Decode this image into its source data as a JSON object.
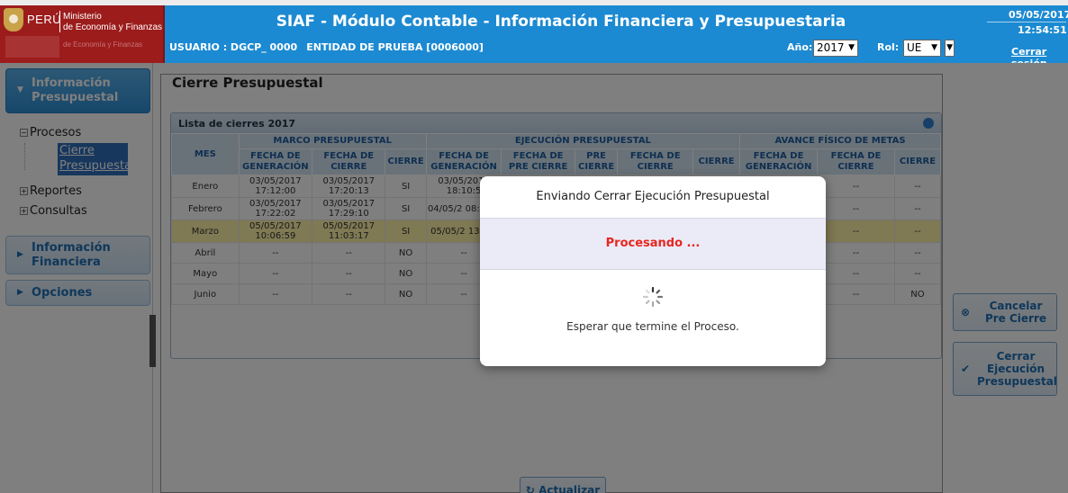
{
  "header": {
    "logo_country": "PERÚ",
    "logo_line1": "Ministerio",
    "logo_line2": "de Economía y Finanzas",
    "logo_line3": "de Economía y Finanzas",
    "title": "SIAF - Módulo Contable - Información Financiera y Presupuestaria",
    "user_label": "USUARIO : DGCP_ 0000",
    "entity_label": "ENTIDAD DE PRUEBA [0006000]",
    "year_label": "Año:",
    "year_value": "2017",
    "role_label": "Rol:",
    "role_value": "UE",
    "date": "05/05/2017",
    "time": "12:54:51",
    "logout": "Cerrar sesión"
  },
  "sidebar": {
    "section1": "Información Presupuestal",
    "procesos": "Procesos",
    "selected_l1": "Cierre",
    "selected_l2": "Presupuestal",
    "reportes": "Reportes",
    "consultas": "Consultas",
    "section2": "Información Financiera",
    "section3": "Opciones"
  },
  "main": {
    "legend": "Cierre Presupuestal",
    "panel_title": "Lista de cierres 2017",
    "groups": [
      "MES",
      "MARCO PRESUPUESTAL",
      "EJECUCIÓN PRESUPUESTAL",
      "AVANCE FÍSICO DE METAS"
    ],
    "columns": [
      "FECHA DE GENERACIÓN",
      "FECHA DE CIERRE",
      "CIERRE",
      "FECHA DE GENERACIÓN",
      "FECHA DE PRE CIERRE",
      "PRE CIERRE",
      "FECHA DE CIERRE",
      "CIERRE",
      "FECHA DE GENERACIÓN",
      "FECHA DE CIERRE",
      "CIERRE"
    ],
    "rows": [
      [
        "Enero",
        "03/05/2017 17:12:00",
        "03/05/2017 17:20:13",
        "SI",
        "03/05/2017 18:10:5",
        "",
        "",
        "",
        "",
        "--",
        "--",
        "--"
      ],
      [
        "Febrero",
        "03/05/2017 17:22:02",
        "03/05/2017 17:29:10",
        "SI",
        "04/05/2 08:14:2",
        "",
        "",
        "",
        "",
        "--",
        "--",
        "--"
      ],
      [
        "Marzo",
        "05/05/2017 10:06:59",
        "05/05/2017 11:03:17",
        "SI",
        "05/05/2 13:14:",
        "",
        "",
        "",
        "",
        "--",
        "--",
        "--"
      ],
      [
        "Abril",
        "--",
        "--",
        "NO",
        "--",
        "",
        "",
        "",
        "",
        "--",
        "--",
        "--"
      ],
      [
        "Mayo",
        "--",
        "--",
        "NO",
        "--",
        "",
        "",
        "",
        "",
        "--",
        "--",
        "--"
      ],
      [
        "Junio",
        "--",
        "--",
        "NO",
        "--",
        "",
        "",
        "",
        "",
        "--",
        "--",
        "NO"
      ]
    ],
    "refresh_button": "Actualizar",
    "cancel_button_l1": "Cancelar",
    "cancel_button_l2": "Pre Cierre",
    "close_button_l1": "Cerrar",
    "close_button_l2": "Ejecución",
    "close_button_l3": "Presupuestal"
  },
  "modal": {
    "title": "Enviando Cerrar Ejecución Presupuestal",
    "status": "Procesando ...",
    "message": "Esperar que termine el Proceso."
  },
  "colors": {
    "header_blue": "#1c8ad2",
    "logo_red": "#9c1c1c",
    "highlight_row": "#fff2a8",
    "status_red": "#e8261f"
  }
}
